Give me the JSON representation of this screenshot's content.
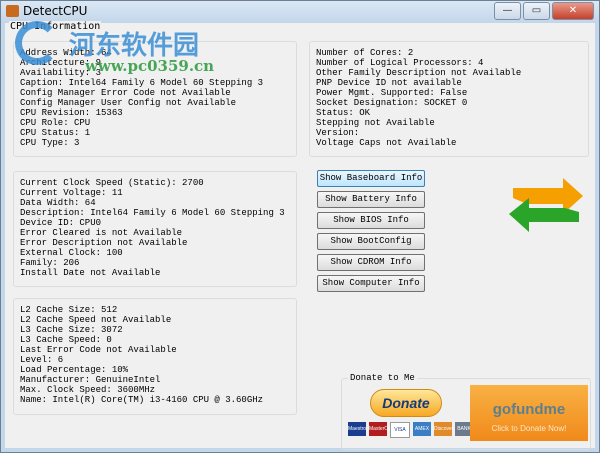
{
  "window": {
    "title": "DetectCPU",
    "minimize": "—",
    "maximize": "▭",
    "close": "✕"
  },
  "group_label": "CPU Information",
  "panel1": "Address Width: 64\nArchitecture: 9\nAvailability: 3\nCaption: Intel64 Family 6 Model 60 Stepping 3\nConfig Manager Error Code not Available\nConfig Manager User Config not Available\nCPU Revision: 15363\nCPU Role: CPU\nCPU Status: 1\nCPU Type: 3",
  "panel2": "Number of Cores: 2\nNumber of Logical Processors: 4\nOther Family Description not Available\nPNP Device ID not available\nPower Mgmt. Supported: False\nSocket Designation: SOCKET 0\nStatus: OK\nStepping not Available\nVersion:\nVoltage Caps not Available",
  "panel3": "Current Clock Speed (Static): 2700\nCurrent Voltage: 11\nData Width: 64\nDescription: Intel64 Family 6 Model 60 Stepping 3\nDevice ID: CPU0\nError Cleared is not Available\nError Description not Available\nExternal Clock: 100\nFamily: 206\nInstall Date not Available",
  "panel4": "L2 Cache Size: 512\nL2 Cache Speed not Available\nL3 Cache Size: 3072\nL3 Cache Speed: 0\nLast Error Code not Available\nLevel: 6\nLoad Percentage: 10%\nManufacturer: GenuineIntel\nMax. Clock Speed: 3600MHz\nName: Intel(R) Core(TM) i3-4160 CPU @ 3.60GHz",
  "buttons": [
    "Show Baseboard Info",
    "Show Battery Info",
    "Show BIOS Info",
    "Show BootConfig",
    "Show CDROM Info",
    "Show Computer Info"
  ],
  "donate": {
    "label": "Donate to Me",
    "paypal": "Donate",
    "cards": [
      "Maestro",
      "MasterCard",
      "VISA",
      "AMEX",
      "Discover",
      "BANK"
    ],
    "gofundme": "gofundme",
    "gofundme_sub": "Click to Donate Now!"
  },
  "watermark": {
    "name": "河东软件园",
    "url": "www.pc0359.cn"
  }
}
